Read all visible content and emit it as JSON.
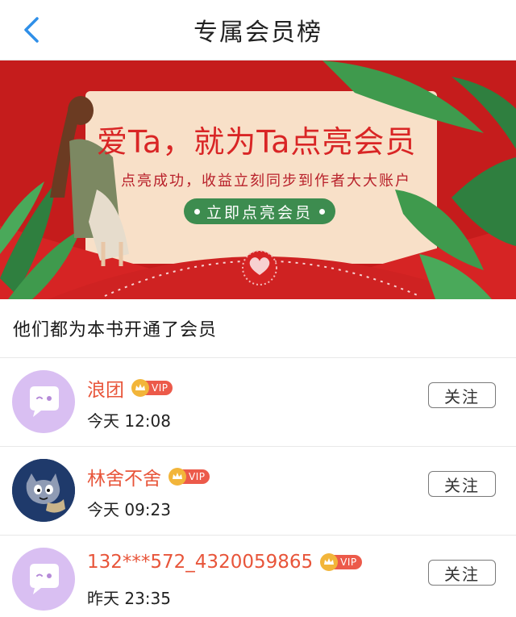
{
  "header": {
    "title": "专属会员榜",
    "back_icon": "chevron-left-icon"
  },
  "banner": {
    "headline": "爱Ta，就为Ta点亮会员",
    "subtitle": "点亮成功，收益立刻同步到作者大大账户",
    "cta_label": "立即点亮会员",
    "colors": {
      "background": "#c51c1c",
      "card": "#f8e0c8",
      "cta": "#3d8c4f",
      "leaf": "#3f9a4d"
    }
  },
  "section": {
    "title": "他们都为本书开通了会员"
  },
  "members": [
    {
      "name": "浪团",
      "vip_label": "VIP",
      "time": "今天 12:08",
      "follow_label": "关注",
      "avatar": "chat-bubble-avatar"
    },
    {
      "name": "林舍不舍",
      "vip_label": "VIP",
      "time": "今天 09:23",
      "follow_label": "关注",
      "avatar": "cartoon-cat-avatar"
    },
    {
      "name": "132***572_4320059865",
      "vip_label": "VIP",
      "time": "昨天 23:35",
      "follow_label": "关注",
      "avatar": "chat-bubble-avatar"
    }
  ],
  "accent_colors": {
    "name": "#e8553a",
    "back_icon": "#2f8fe8",
    "vip_tag": "#ec5a4a",
    "crown": "#f2b53a"
  }
}
